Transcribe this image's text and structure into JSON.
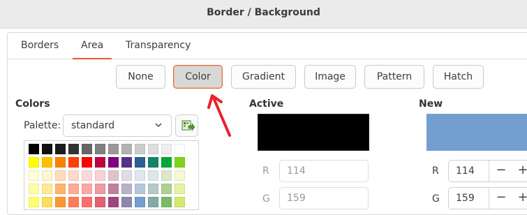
{
  "window": {
    "title": "Border / Background"
  },
  "tabs": [
    {
      "label": "Borders"
    },
    {
      "label": "Area",
      "active": true
    },
    {
      "label": "Transparency"
    }
  ],
  "fill_buttons": [
    {
      "label": "None"
    },
    {
      "label": "Color",
      "selected": true
    },
    {
      "label": "Gradient"
    },
    {
      "label": "Image"
    },
    {
      "label": "Pattern"
    },
    {
      "label": "Hatch"
    }
  ],
  "colors": {
    "heading": "Colors",
    "palette_label": "Palette:",
    "palette_value": "standard",
    "swatches": [
      [
        "#000000",
        "#111111",
        "#1c1c1c",
        "#333333",
        "#666666",
        "#808080",
        "#999999",
        "#b2b2b2",
        "#cccccc",
        "#dddddd",
        "#eeeeee",
        "#ffffff"
      ],
      [
        "#ffff00",
        "#ffbf00",
        "#ff8000",
        "#ff4000",
        "#ff0000",
        "#bf0041",
        "#800080",
        "#55308d",
        "#2a6099",
        "#158466",
        "#00a933",
        "#81d41a"
      ],
      [
        "#ffffd7",
        "#fff5ce",
        "#ffdbb6",
        "#ffd8ce",
        "#ffd7d7",
        "#f7d1d5",
        "#e0c2cd",
        "#dedce6",
        "#dee6ef",
        "#dee7e5",
        "#dde8cb",
        "#f6f9d4"
      ],
      [
        "#ffffa6",
        "#ffe994",
        "#ffb66c",
        "#ffaa95",
        "#ffa6a6",
        "#ec9ba4",
        "#bf819e",
        "#b7b3ca",
        "#b4c7dc",
        "#b3cac7",
        "#afd095",
        "#e8f2a1"
      ],
      [
        "#ffff6d",
        "#ffde59",
        "#ff972f",
        "#ff7b59",
        "#ff6d6d",
        "#e16173",
        "#a1467e",
        "#8e86ae",
        "#729fcf",
        "#81aca6",
        "#77bc65",
        "#d4ea6b"
      ]
    ]
  },
  "active": {
    "heading": "Active",
    "color": "#000000",
    "r": "114",
    "g": "159"
  },
  "new": {
    "heading": "New",
    "color": "#729fcf",
    "r": "114",
    "g": "159"
  },
  "channels": {
    "r": "R",
    "g": "G"
  },
  "stepper": {
    "minus": "−",
    "plus": "+"
  },
  "annotation": {
    "arrow_color": "#e8232a"
  }
}
